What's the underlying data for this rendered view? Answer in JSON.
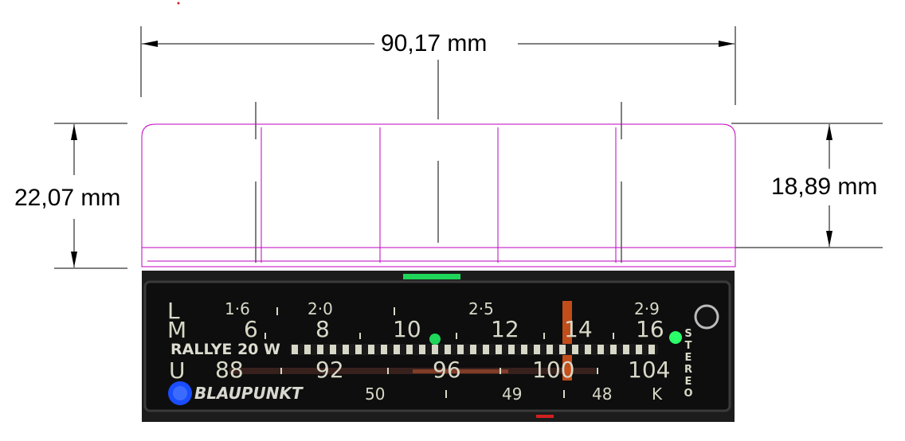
{
  "dimensions": {
    "width_label": "90,17 mm",
    "outer_height_label": "22,07 mm",
    "inner_height_label": "18,89 mm"
  },
  "dial": {
    "band_L": {
      "letter": "L",
      "ticks": [
        "1·6",
        "2·0",
        "2·5",
        "2·9"
      ]
    },
    "band_M": {
      "letter": "M",
      "ticks": [
        "6",
        "8",
        "10",
        "12",
        "14",
        "16"
      ]
    },
    "rallye_label": "RALLYE 20 W",
    "band_U": {
      "letter": "U",
      "ticks": [
        "88",
        "92",
        "96",
        "100",
        "104"
      ]
    },
    "brand": "BLAUPUNKT",
    "band_K": {
      "ticks": [
        "50",
        "49",
        "48"
      ],
      "letter": "K"
    },
    "stereo_label": "STEREO"
  },
  "colors": {
    "outline_magenta": "#c000c0",
    "dimension_black": "#000000",
    "indicator_green": "#1fd65a",
    "pointer_orange": "#e0581c",
    "blue_led": "#1a4dff"
  }
}
